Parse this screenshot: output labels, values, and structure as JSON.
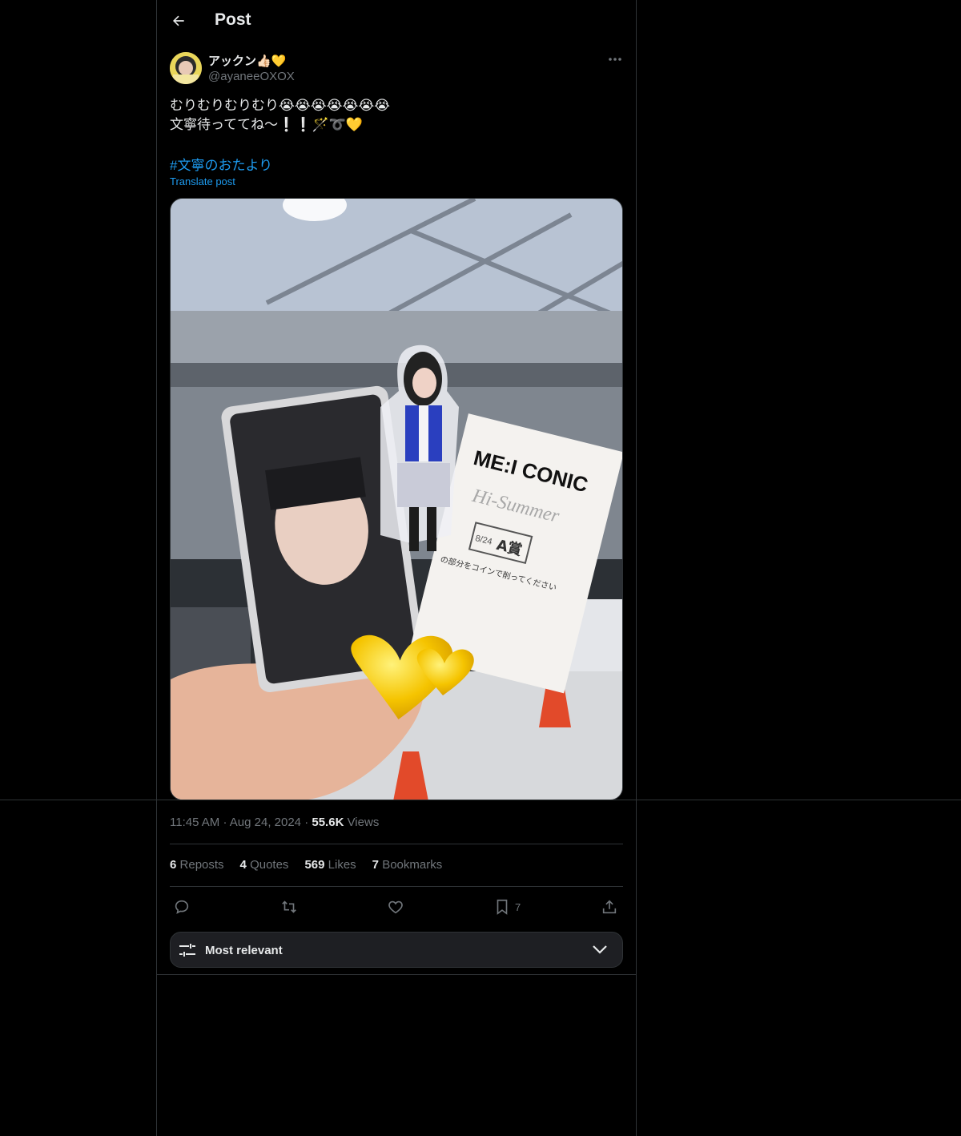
{
  "header": {
    "title": "Post"
  },
  "author": {
    "name": "アックン👍🏻💛",
    "handle": "@ayaneeOXOX"
  },
  "post": {
    "line1": "むりむりむりむり😭😭😭😭😭😭😭",
    "line2": "文寧待っててね〜❕❕🪄➰💛",
    "hashtag": "#文寧のおたより",
    "translate": "Translate post"
  },
  "media": {
    "card_brand": "ME:I CONIC",
    "card_script": "Hi-Summer",
    "card_prize": "A賞",
    "card_date": "8/24",
    "card_note": "の部分をコインで削ってください"
  },
  "meta": {
    "time": "11:45 AM",
    "date": "Aug 24, 2024",
    "views_count": "55.6K",
    "views_label": "Views",
    "dot": "·"
  },
  "stats": {
    "reposts_count": "6",
    "reposts_label": "Reposts",
    "quotes_count": "4",
    "quotes_label": "Quotes",
    "likes_count": "569",
    "likes_label": "Likes",
    "bookmarks_count": "7",
    "bookmarks_label": "Bookmarks"
  },
  "actions": {
    "bookmark_count": "7"
  },
  "sort": {
    "label": "Most relevant"
  },
  "colors": {
    "accent": "#1d9bf0",
    "muted": "#71767b",
    "text": "#e7e9ea",
    "border": "#2f3336"
  },
  "icons": [
    "back-arrow-icon",
    "more-icon",
    "reply-icon",
    "repost-icon",
    "like-icon",
    "bookmark-icon",
    "share-icon",
    "sliders-icon",
    "chevron-down-icon"
  ]
}
